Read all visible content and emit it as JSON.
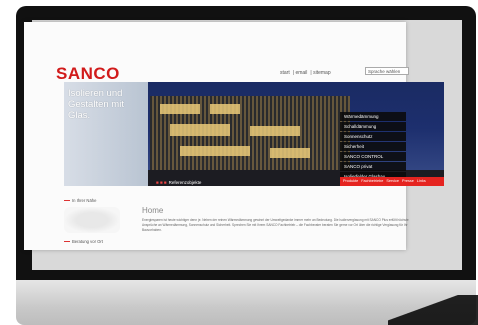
{
  "site": {
    "logo": "SANCO",
    "topnav": [
      "start",
      "email",
      "sitemap"
    ],
    "language": "Sprache wählen"
  },
  "hero": {
    "tagline": "Isolieren und Gestalten mit Glas.",
    "menu": [
      "Wärmedämmung",
      "Schalldämmung",
      "Sonnenschutz",
      "Sicherheit",
      "SANCO CONTROL",
      "SANCO privat",
      "Isolierfelder Glasbau"
    ],
    "tabs": [
      "Produkte",
      "Fachbetriebe",
      "Service",
      "Presse",
      "Links"
    ],
    "caption_marks": "■ ■ ■",
    "caption_text": "Referenzobjekte"
  },
  "sidebar": {
    "links": [
      "In Ihrer Nähe",
      "Beratung vor Ort"
    ]
  },
  "content": {
    "heading": "Home",
    "body": "Energiesparen ist heute wichtiger denn je. Neben der reinen Wärmedämmung gewinnt der Umweltgedanke immer mehr an Bedeutung. Die Isolierverglasung mit SANCO Plus erfüllt höchste Ansprüche an Wärmedämmung, Sonnenschutz und Sicherheit. Sprechen Sie mit Ihrem SANCO Fachbetrieb – die Fachberater beraten Sie gerne vor Ort über die richtige Verglasung für Ihr Bauvorhaben."
  },
  "colors": {
    "brand_red": "#d11b1b",
    "hero_blue": "#1d2f6e"
  }
}
